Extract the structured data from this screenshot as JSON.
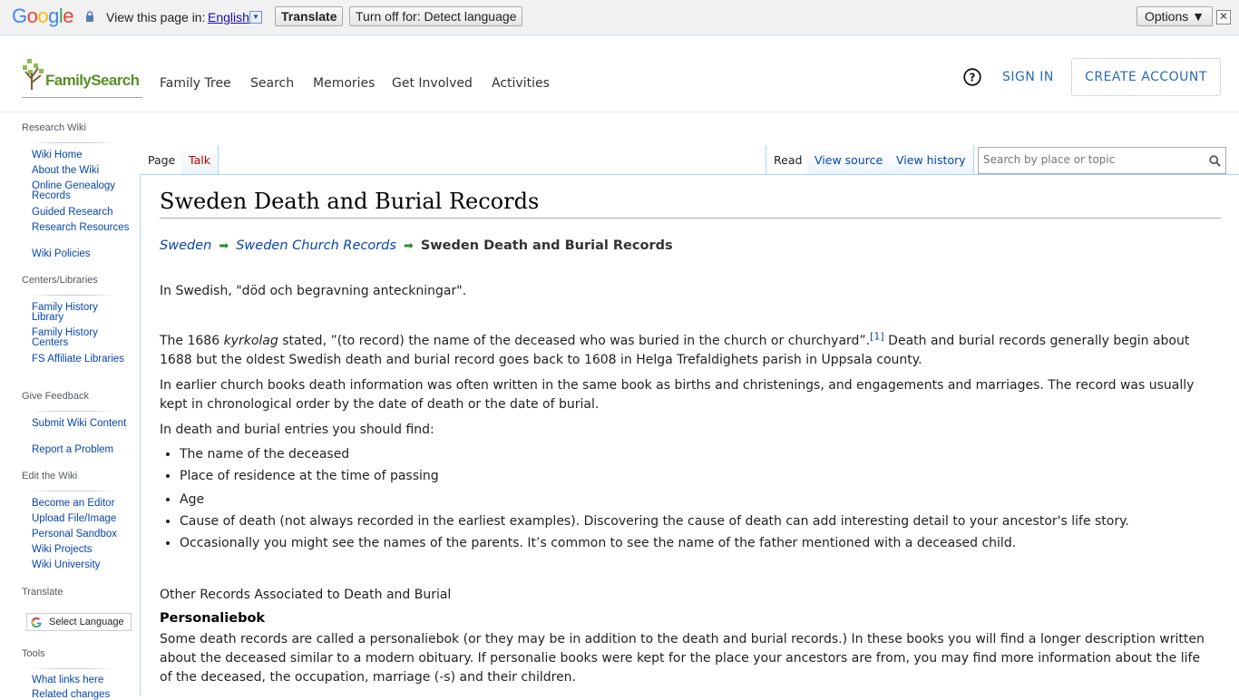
{
  "google_bar": {
    "logo": "Google",
    "logo_colors": [
      "#4285F4",
      "#EA4335",
      "#FBBC05",
      "#4285F4",
      "#34A853",
      "#EA4335"
    ],
    "view_prompt": "View this page in:",
    "language": "English",
    "translate_label": "Translate",
    "turnoff_label": "Turn off for: Detect language",
    "options_label": "Options ▼",
    "close_glyph": "✕"
  },
  "header": {
    "logo_text": "FamilySearch",
    "nav": [
      "Family Tree",
      "Search",
      "Memories",
      "Get Involved",
      "Activities"
    ],
    "help_glyph": "?",
    "sign_in": "SIGN IN",
    "create_account": "CREATE ACCOUNT",
    "accent": "#2a6aad",
    "brand": "#5a8f28"
  },
  "sidebar": {
    "sections": [
      {
        "heading": "Research Wiki",
        "items": [
          "Wiki Home",
          "About the Wiki",
          "Online Genealogy Records",
          "Guided Research",
          "Research Resources",
          "Wiki Policies"
        ]
      },
      {
        "heading": "Centers/Libraries",
        "items": [
          "Family History Library",
          "Family History Centers",
          "FS Affiliate Libraries"
        ]
      },
      {
        "heading": "Give Feedback",
        "items": [
          "Submit Wiki Content",
          "Report a Problem"
        ]
      },
      {
        "heading": "Edit the Wiki",
        "items": [
          "Become an Editor",
          "Upload File/Image",
          "Personal Sandbox",
          "Wiki Projects",
          "Wiki University"
        ]
      },
      {
        "heading": "Translate",
        "items": []
      },
      {
        "heading": "Tools",
        "items": [
          "What links here",
          "Related changes"
        ]
      }
    ],
    "translate_widget": "Select Language"
  },
  "tabs": {
    "page": "Page",
    "talk": "Talk",
    "read": "Read",
    "view_source": "View source",
    "view_history": "View history"
  },
  "search": {
    "placeholder": "Search by place or topic"
  },
  "article": {
    "title": "Sweden Death and Burial Records",
    "breadcrumb": [
      "Sweden",
      "Sweden Church Records",
      "Sweden Death and Burial Records"
    ],
    "breadcrumb_arrow": "➡",
    "intro": "In Swedish, \"död och begravning anteckningar\".",
    "p1_a": "The 1686 ",
    "p1_italic": "kyrkolag",
    "p1_b": " stated, ”(to record) the name of the deceased who was buried in the church or churchyard”.",
    "p1_ref": "[1]",
    "p1_c": " Death and burial records generally begin about 1688 but the oldest Swedish death and burial record goes back to 1608 in Helga Trefaldighets parish in Uppsala county.",
    "p2": "In earlier church books death information was often written in the same book as births and christenings, and engagements and marriages. The record was usually kept in chronological order by the date of death or the date of burial.",
    "p3": "In death and burial entries you should find:",
    "list": [
      "The name of the deceased",
      "Place of residence at the time of passing",
      "Age",
      "Cause of death (not always recorded in the earliest examples). Discovering the cause of death can add interesting detail to your ancestor's life story.",
      "Occasionally you might see the names of the parents. It’s common to see the name of the father mentioned with a deceased child."
    ],
    "other_records": "Other Records Associated to Death and Burial",
    "personaliebok_heading": "Personaliebok",
    "personaliebok_text": "Some death records are called a personaliebok (or they may be in addition to the death and burial records.) In these books you will find a longer description written about the deceased similar to a modern obituary. If personalie books were kept for the place your ancestors are from, you may find more information about the life of the deceased, the occupation, marriage (-s) and their children."
  }
}
